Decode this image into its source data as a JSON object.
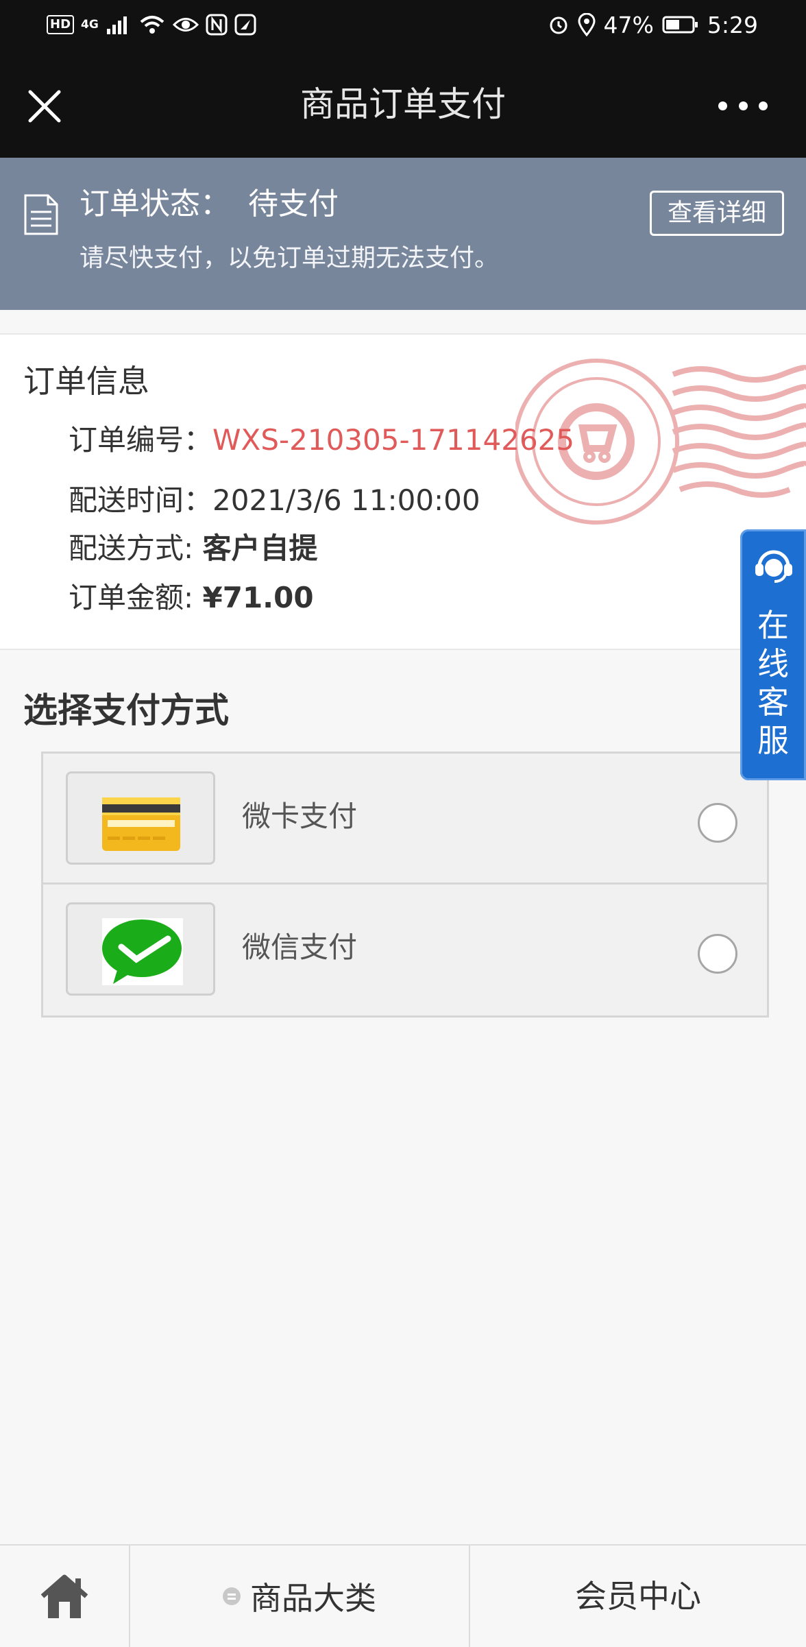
{
  "status_bar": {
    "network_hd": "HD",
    "network_type": "4G",
    "battery_percent": "47%",
    "time": "5:29"
  },
  "header": {
    "title": "商品订单支付"
  },
  "status_banner": {
    "label": "订单状态：",
    "value": "待支付",
    "hint": "请尽快支付，以免订单过期无法支付。",
    "detail_button": "查看详细"
  },
  "order_info": {
    "title": "订单信息",
    "order_no_label": "订单编号：",
    "order_no": "WXS-210305-171142625",
    "delivery_time_label": "配送时间：",
    "delivery_time": "2021/3/6 11:00:00",
    "delivery_method_label": "配送方式: ",
    "delivery_method": "客户自提",
    "amount_label": "订单金额: ",
    "amount": "¥71.00"
  },
  "payment": {
    "title": "选择支付方式",
    "options": [
      {
        "label": "微卡支付",
        "icon": "bank-card-icon",
        "selected": false
      },
      {
        "label": "微信支付",
        "icon": "wechat-pay-icon",
        "selected": false
      }
    ]
  },
  "service_tab": {
    "label": "在线客服",
    "icon": "customer-service-icon"
  },
  "bottom_nav": {
    "category": "商品大类",
    "member": "会员中心"
  },
  "colors": {
    "banner": "#78869c",
    "order_no": "#e15a5a",
    "service_tab": "#1d6fd1",
    "wechat_green": "#1aad19"
  }
}
